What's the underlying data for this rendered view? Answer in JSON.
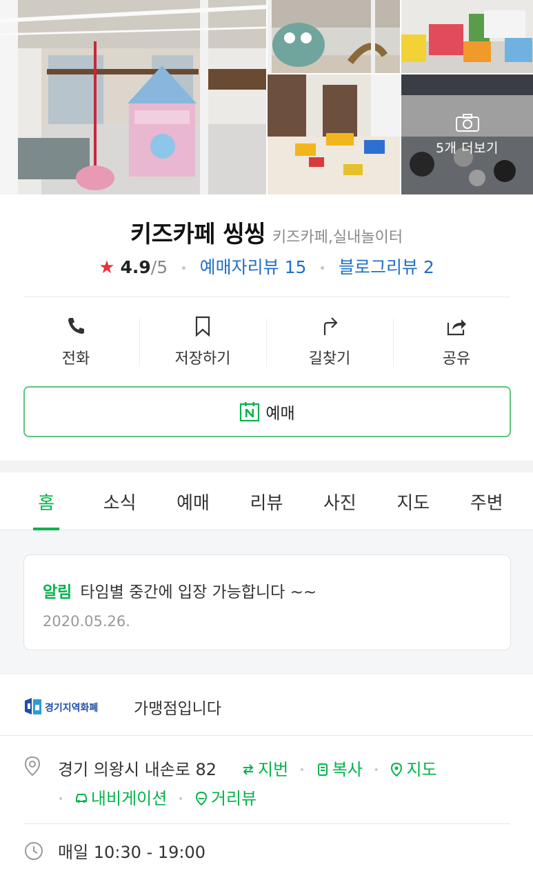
{
  "gallery": {
    "more_label": "5개 더보기",
    "more_icon": "camera-icon"
  },
  "place": {
    "name": "키즈카페 씽씽",
    "category": "키즈카페,실내놀이터",
    "rating": "4.9",
    "rating_max": "/5",
    "booking_review": "예매자리뷰 15",
    "blog_review": "블로그리뷰 2"
  },
  "actions": [
    {
      "label": "전화",
      "icon": "phone-icon"
    },
    {
      "label": "저장하기",
      "icon": "bookmark-icon"
    },
    {
      "label": "길찾기",
      "icon": "directions-icon"
    },
    {
      "label": "공유",
      "icon": "share-icon"
    }
  ],
  "reserve": {
    "label": "예매",
    "icon": "naver-booking-icon"
  },
  "tabs": [
    "홈",
    "소식",
    "예매",
    "리뷰",
    "사진",
    "지도",
    "주변"
  ],
  "notice": {
    "tag": "알림",
    "text": "타임별 중간에 입장 가능합니다 ~~",
    "date": "2020.05.26."
  },
  "local_currency": {
    "logo_text": "경기지역화폐",
    "label": "가맹점입니다"
  },
  "address": {
    "text": "경기 의왕시 내손로 82",
    "links_top": [
      "지번",
      "복사",
      "지도"
    ],
    "links_bottom": [
      "내비게이션",
      "거리뷰"
    ]
  },
  "hours": {
    "text": "매일 10:30 - 19:00"
  },
  "colors": {
    "accent_green": "#03b34a",
    "link_blue": "#1e6fc8",
    "star_red": "#e8313a"
  }
}
